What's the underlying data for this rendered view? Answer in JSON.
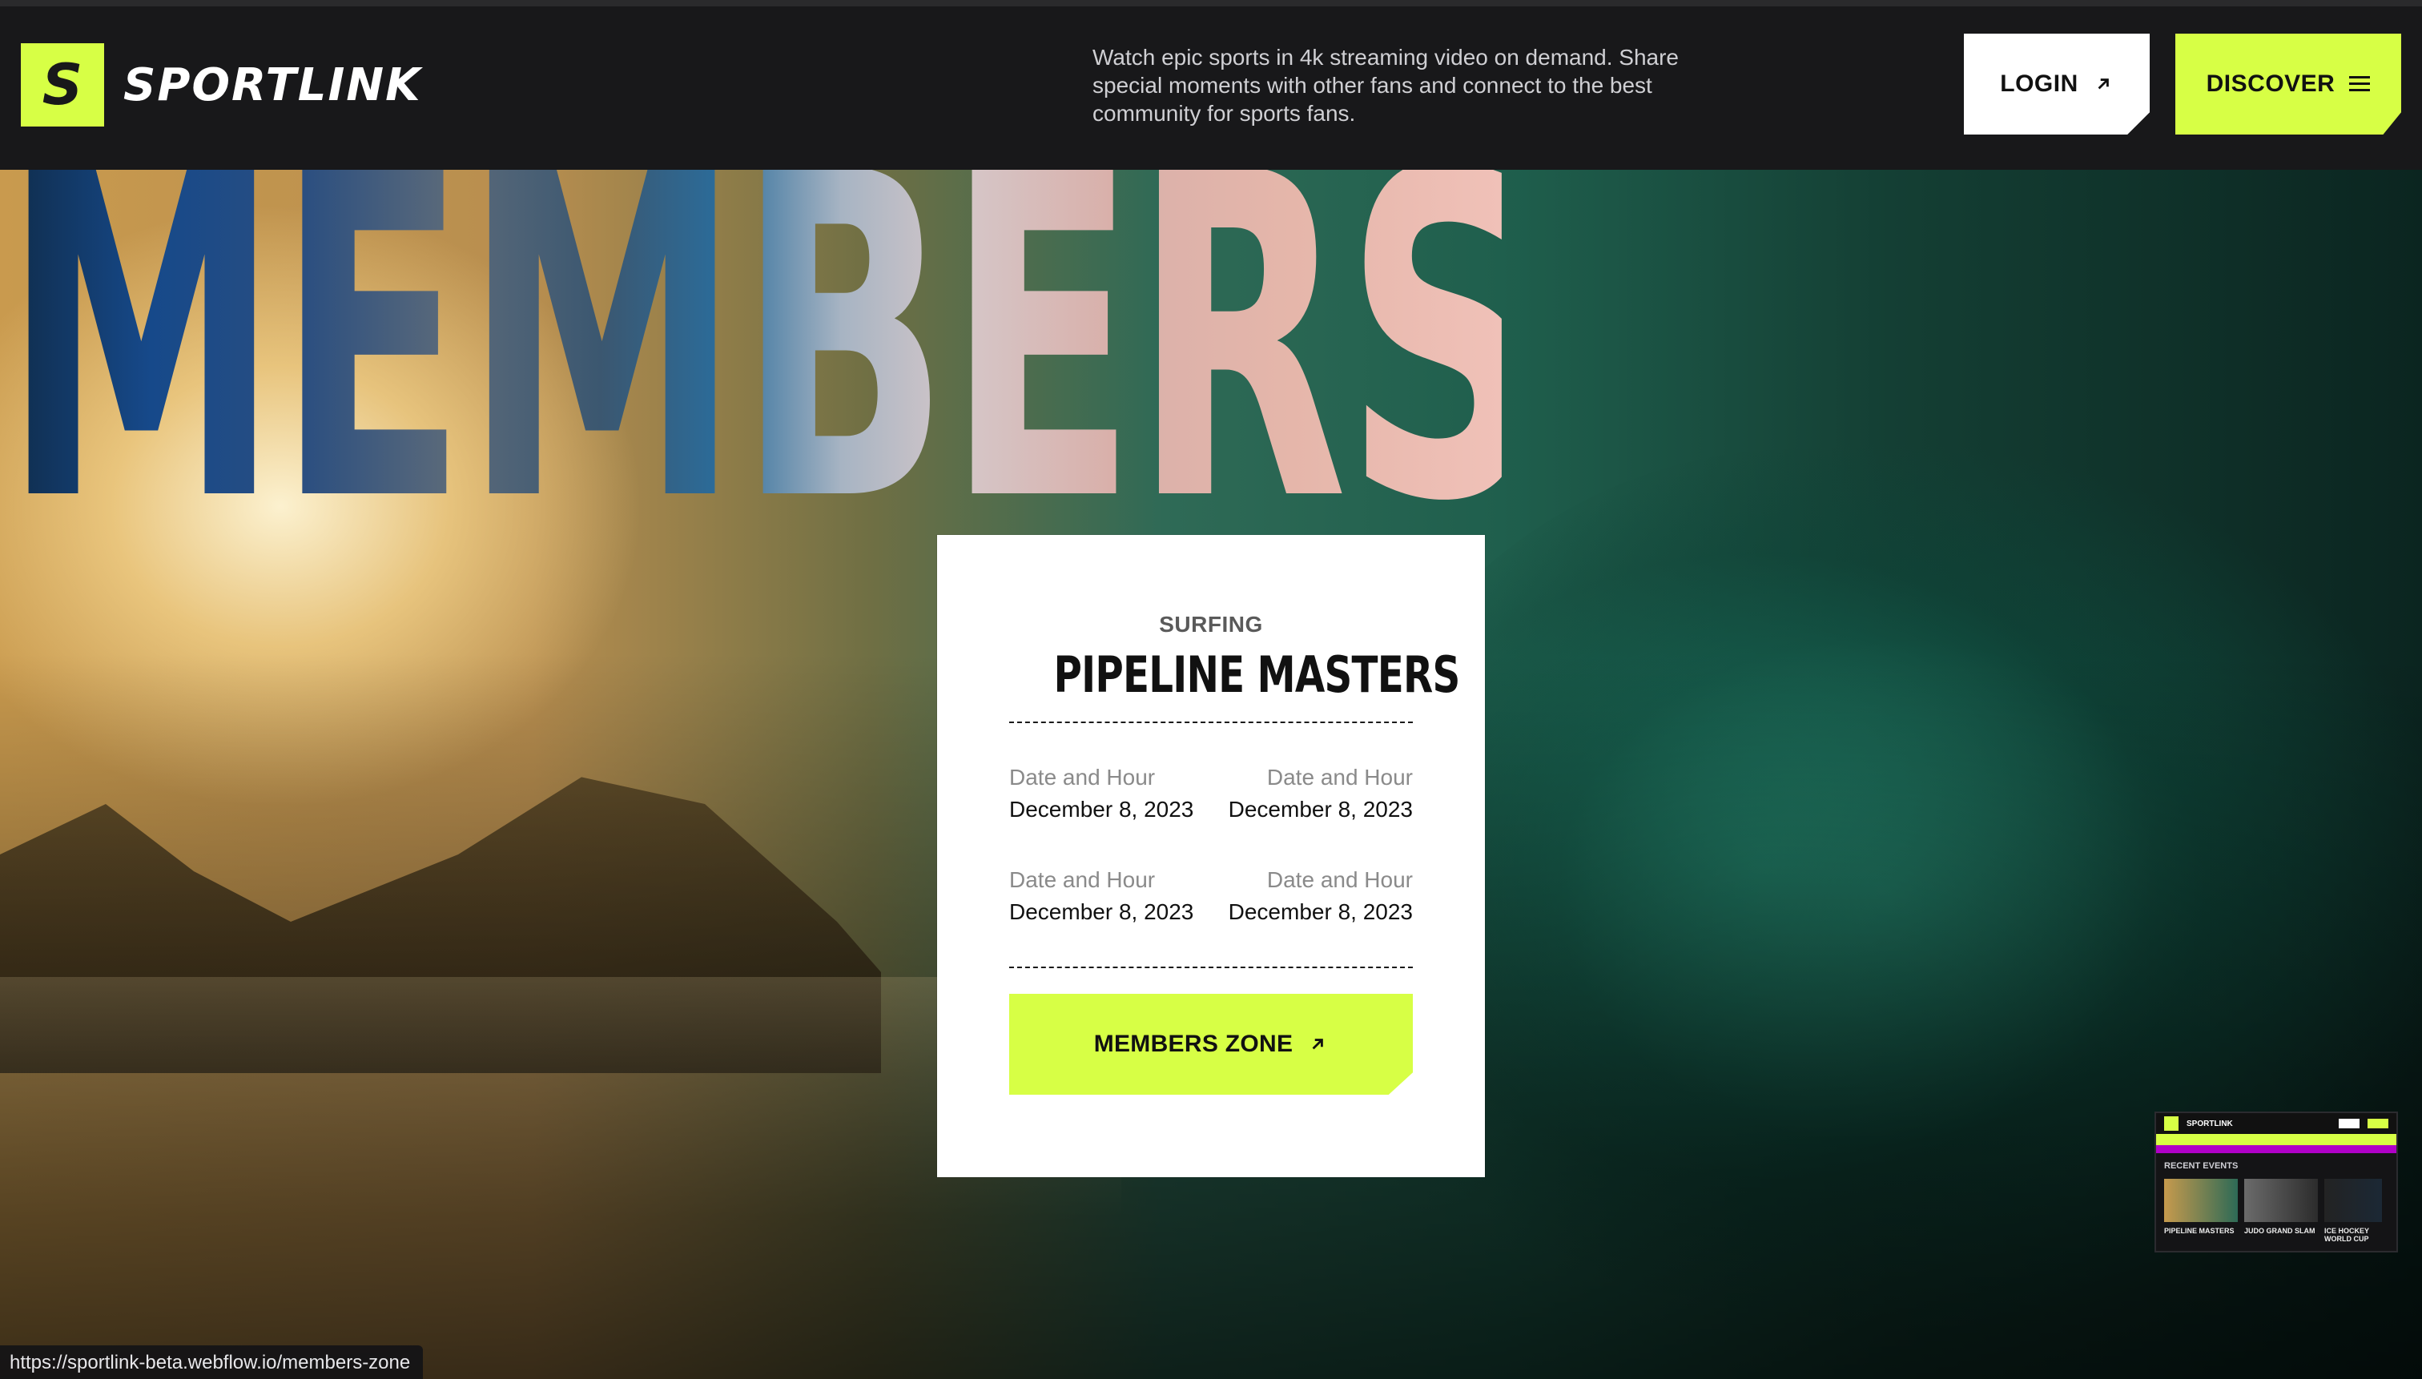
{
  "header": {
    "brand": "SPORTLINK",
    "brand_mark": "S",
    "tagline": "Watch epic sports in 4k streaming video on demand. Share special moments with other fans and connect to the best community for sports fans.",
    "login_label": "LOGIN",
    "discover_label": "DISCOVER"
  },
  "hero": {
    "headline": "MEMBERS ONLY"
  },
  "event_card": {
    "category": "SURFING",
    "title": "PIPELINE MASTERS",
    "schedule": [
      {
        "left_label": "Date and Hour",
        "left_value": "December 8, 2023",
        "right_label": "Date and Hour",
        "right_value": "December 8, 2023"
      },
      {
        "left_label": "Date and Hour",
        "left_value": "December 8, 2023",
        "right_label": "Date and Hour",
        "right_value": "December 8, 2023"
      }
    ],
    "cta_label": "MEMBERS ZONE"
  },
  "preview": {
    "brand": "SPORTLINK",
    "section_label": "RECENT EVENTS",
    "items": [
      "PIPELINE MASTERS",
      "JUDO GRAND SLAM",
      "ICE HOCKEY WORLD CUP"
    ]
  },
  "status_bar": {
    "url": "https://sportlink-beta.webflow.io/members-zone"
  },
  "icons": {
    "login": "arrow-up-right-icon",
    "discover": "menu-icon",
    "cta": "arrow-up-right-icon"
  },
  "colors": {
    "accent": "#d7ff45",
    "topbar_bg": "#18181a",
    "card_bg": "#ffffff"
  }
}
